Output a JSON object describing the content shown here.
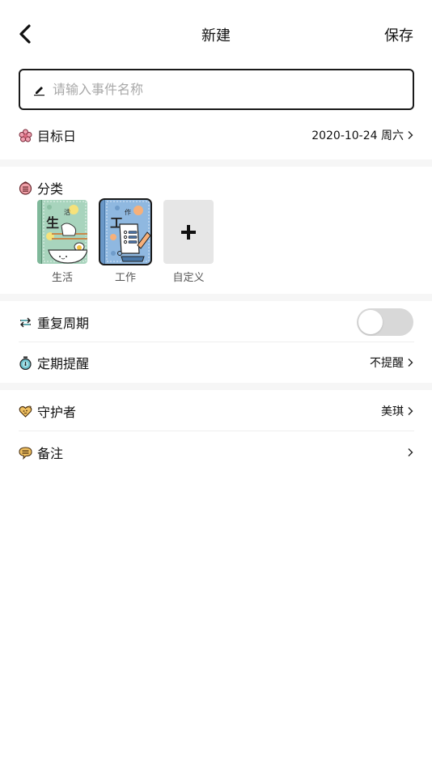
{
  "header": {
    "title": "新建",
    "save_label": "保存"
  },
  "name_input": {
    "placeholder": "请输入事件名称",
    "value": ""
  },
  "target_date": {
    "label": "目标日",
    "value": "2020-10-24 周六",
    "icon": "flower-icon"
  },
  "category": {
    "label": "分类",
    "icon": "category-icon",
    "items": [
      {
        "label": "生活",
        "cover_text_big": "生",
        "cover_text_small": "活",
        "selected": false
      },
      {
        "label": "工作",
        "cover_text_big": "工",
        "cover_text_small": "作",
        "selected": true
      },
      {
        "label": "自定义",
        "icon": "plus-icon",
        "selected": false
      }
    ]
  },
  "repeat": {
    "label": "重复周期",
    "icon": "repeat-icon",
    "enabled": false
  },
  "reminder": {
    "label": "定期提醒",
    "value": "不提醒",
    "icon": "stopwatch-icon"
  },
  "guardian": {
    "label": "守护者",
    "value": "美琪",
    "icon": "heart-face-icon"
  },
  "note": {
    "label": "备注",
    "value": "",
    "icon": "speech-bubble-icon"
  },
  "colors": {
    "border": "#1a1a1a",
    "section_gap": "#f6f6f6",
    "toggle_off": "#d8d8d8",
    "life_cover": "#a8d4bd",
    "work_cover": "#8fb8e0"
  }
}
